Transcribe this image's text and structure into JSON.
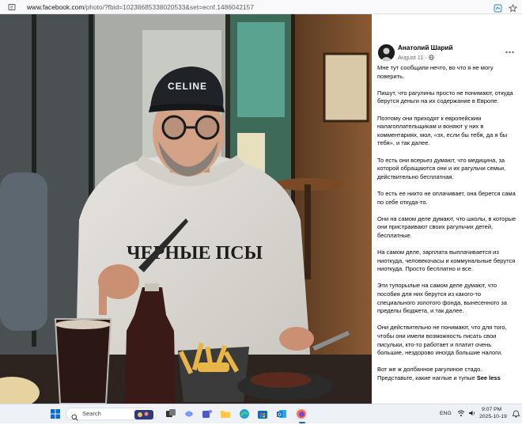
{
  "browser": {
    "url_host": "www.facebook.com",
    "url_path": "/photo/?fbid=10238685338020533&set=ecnf.1486042157"
  },
  "post": {
    "author": "Анатолий Шарий",
    "date": "August 11 · ",
    "shirt_text": "ЧЕРНЫЕ ПСЫ",
    "cap_text": "CELINE",
    "paragraphs": [
      "Мне тут сообщили нечто, во что я не могу поверить.",
      "Пишут, что рагулины просто не понимают, откуда берутся деньги на их содержание в Европе.",
      "Поэтому они приходят к европейским налагоплательщикам и воняют у них в комментариях, мол, «эх, если бы тебя, да я бы тебя», и так далее.",
      "То есть они всерьез думают, что медицина, за которой обращаются они и их рагульчи семьи, действительно бесплатная.",
      "То есть ее никто не оплачивает, она берется сама по себе откуда-то.",
      "Они на самом деле думают, что школы, в которые они пристраивают своих рагульчих детей, бесплатные.",
      "На самом деле, зарплата выплачивается из ниоткуда, человекочасы и коммунальные берутся ниоткуда. Просто бесплатно и все.",
      "Эти тупорылые на самом деле думают, что пособия для них берутся из какого-то специального золотого фонда, вынесенного за пределы бюджета, и так далее.",
      "Они действительно не понимают, что для того, чтобы они имели возможность писать свои писульки, кто-то работает и платит очень большие, нездорово иногда большие налоги."
    ],
    "last_paragraph": "Вот же ж долбанное рагулиное стадо. Представьте, какие наглые и тупые ",
    "see_less": "See less"
  },
  "taskbar": {
    "search_placeholder": "Search",
    "language": "ENG",
    "time": "9:07 PM",
    "date": "2025-10-19"
  },
  "colors": {
    "taskbar_bg": "#eef2f7",
    "facebook_text": "#050505",
    "secondary_text": "#65676b"
  }
}
